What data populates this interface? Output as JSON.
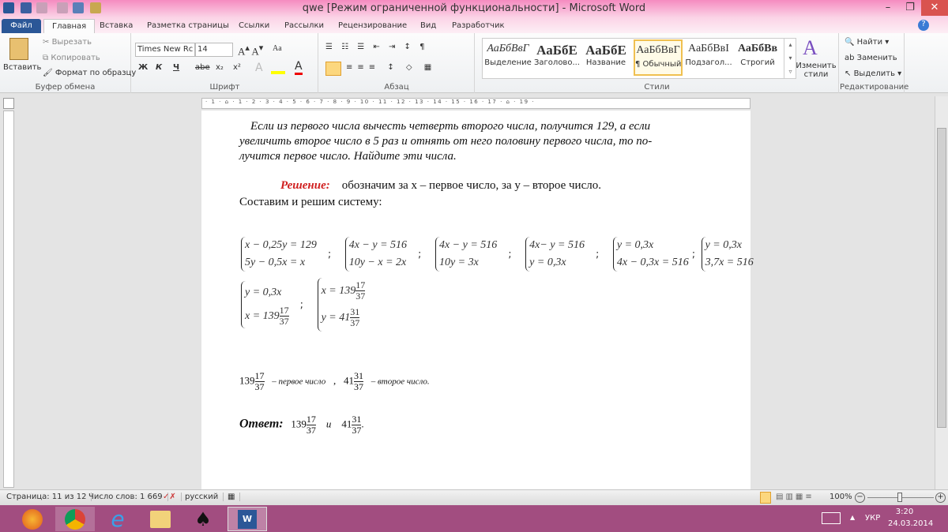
{
  "window": {
    "title": "qwe [Режим ограниченной функциональности]  -  Microsoft Word"
  },
  "tabs": [
    "Файл",
    "Главная",
    "Вставка",
    "Разметка страницы",
    "Ссылки",
    "Рассылки",
    "Рецензирование",
    "Вид",
    "Разработчик"
  ],
  "clipboard": {
    "paste": "Вставить",
    "cut": "Вырезать",
    "copy": "Копировать",
    "format": "Формат по образцу",
    "label": "Буфер обмена"
  },
  "font": {
    "name": "Times New Rc",
    "size": "14",
    "label": "Шрифт",
    "bold": "Ж",
    "italic": "К",
    "underline": "Ч",
    "strike": "abe",
    "sub": "x₂",
    "sup": "x²",
    "case": "Aa"
  },
  "paragraph": {
    "label": "Абзац"
  },
  "styles": {
    "label": "Стили",
    "items": [
      {
        "preview": "АаБбВвГ",
        "name": "Выделение"
      },
      {
        "preview": "АаБбЕ",
        "name": "Заголово..."
      },
      {
        "preview": "АаБбЕ",
        "name": "Название"
      },
      {
        "preview": "АаБбВвГ",
        "name": "¶ Обычный"
      },
      {
        "preview": "АаБбВвІ",
        "name": "Подзагол..."
      },
      {
        "preview": "АаБбВв",
        "name": "Строгий"
      }
    ],
    "change": "Изменить стили"
  },
  "editing": {
    "label": "Редактирование",
    "find": "Найти",
    "replace": "Заменить",
    "select": "Выделить"
  },
  "ruler": "· 1 · ⌂ · 1 · 2 · 3 · 4 · 5 · 6 · 7 · 8 · 9 · 10 · 11 · 12 · 13 · 14 · 15 · 16 · 17 · ⌂ · 19 ·",
  "doc": {
    "p1": "Если из первого числа вычесть четверть второго числа, получится 129, а если",
    "p2": "увеличить второе число в 5 раз и отнять от него  половину первого числа, то по-",
    "p3": "лучится первое число. Найдите эти числа.",
    "solution_label": "Решение:",
    "solution_text": "обозначим за  x – первое число, за  y – второе число.",
    "compose": "Составим и решим систему:",
    "systems": [
      [
        "x − 0,25y = 129",
        "5y − 0,5x = x"
      ],
      [
        "4x − y = 516",
        "10y − x = 2x"
      ],
      [
        "4x − y = 516",
        "10y = 3x"
      ],
      [
        "4x− y = 516",
        "y = 0,3x"
      ],
      [
        "y = 0,3x",
        "4x − 0,3x = 516"
      ],
      [
        "y = 0,3x",
        "3,7x = 516"
      ]
    ],
    "sep": ";",
    "sys7": {
      "l1": "y = 0,3x",
      "l2": "x = 139"
    },
    "sys8": {
      "l1": "x = 139",
      "l2": "y = 41"
    },
    "w139": "139",
    "w41": "41",
    "n17": "17",
    "n31": "31",
    "d37": "37",
    "first": "–   первое   число",
    "comma": ",",
    "second": "–   второе   число.",
    "answer_label": "Ответ:",
    "and": "и",
    "dot": "."
  },
  "status": {
    "page": "Страница: 11 из 12",
    "words": "Число слов: 1 669",
    "lang": "русский",
    "zoom": "100%",
    "zoom_percent": 100
  },
  "taskbar": {
    "lang": "УКР",
    "time": "3:20",
    "date": "24.03.2014"
  }
}
